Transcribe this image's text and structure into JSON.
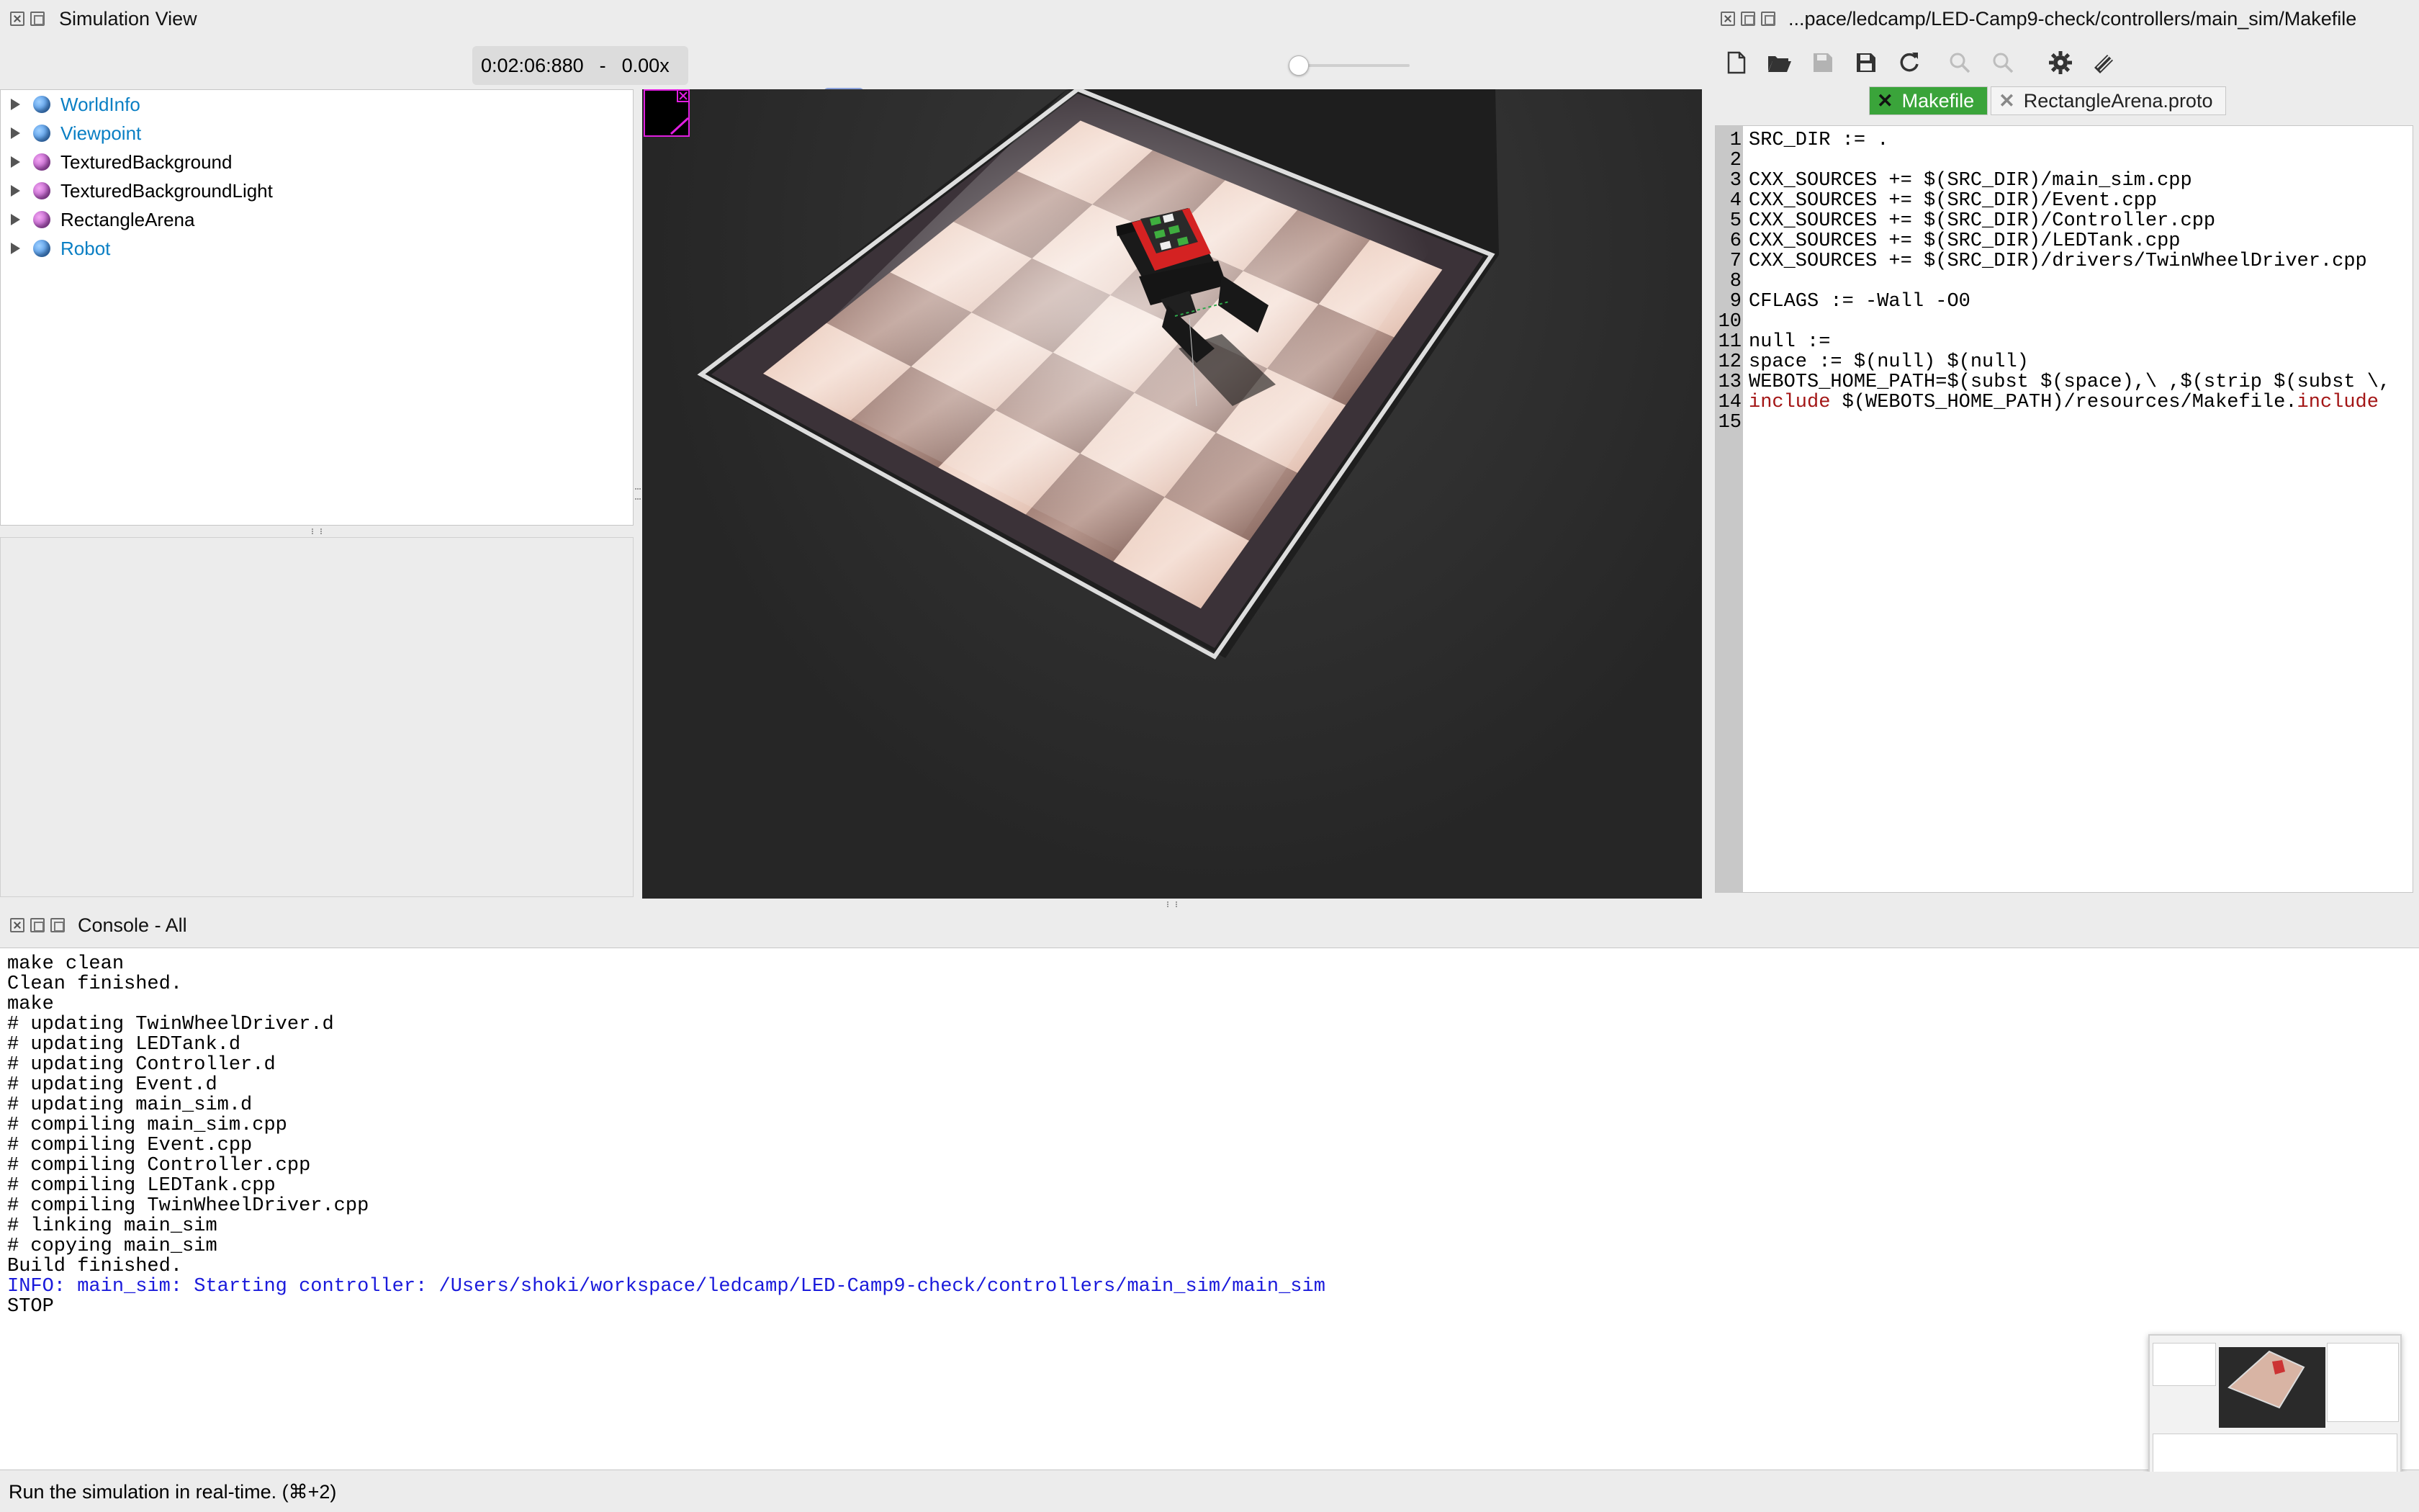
{
  "sim": {
    "title": "Simulation View",
    "time": "0:02:06:880",
    "dash": "-",
    "speed": "0.00x"
  },
  "toolbar": {
    "icons": [
      "toggle-scene-tree-icon",
      "add-node-icon",
      "reset-view-icon",
      "eye-icon",
      "open-world-icon",
      "save-world-icon",
      "reload-world-icon",
      "step-back-icon",
      "step-icon",
      "play-icon",
      "fast-forward-icon",
      "projection-icon",
      "movie-icon",
      "record-icon",
      "screenshot-icon",
      "mute-icon"
    ],
    "volume": 0.05
  },
  "tree": {
    "items": [
      {
        "label": "WorldInfo",
        "color": "blue",
        "highlight": true
      },
      {
        "label": "Viewpoint",
        "color": "blue",
        "highlight": true
      },
      {
        "label": "TexturedBackground",
        "color": "purple",
        "highlight": false
      },
      {
        "label": "TexturedBackgroundLight",
        "color": "purple",
        "highlight": false
      },
      {
        "label": "RectangleArena",
        "color": "purple",
        "highlight": false
      },
      {
        "label": "Robot",
        "color": "blue",
        "highlight": true
      }
    ]
  },
  "editor": {
    "title": "...pace/ledcamp/LED-Camp9-check/controllers/main_sim/Makefile",
    "tabs": [
      {
        "label": "Makefile",
        "active": true
      },
      {
        "label": "RectangleArena.proto",
        "active": false
      }
    ],
    "lines": [
      [
        {
          "t": "SRC_DIR := ."
        }
      ],
      [
        {
          "t": ""
        }
      ],
      [
        {
          "t": "CXX_SOURCES += $(SRC_DIR)/main_sim.cpp"
        }
      ],
      [
        {
          "t": "CXX_SOURCES += $(SRC_DIR)/Event.cpp"
        }
      ],
      [
        {
          "t": "CXX_SOURCES += $(SRC_DIR)/Controller.cpp"
        }
      ],
      [
        {
          "t": "CXX_SOURCES += $(SRC_DIR)/LEDTank.cpp"
        }
      ],
      [
        {
          "t": "CXX_SOURCES += $(SRC_DIR)/drivers/TwinWheelDriver.cpp"
        }
      ],
      [
        {
          "t": ""
        }
      ],
      [
        {
          "t": "CFLAGS := -Wall -O0"
        }
      ],
      [
        {
          "t": ""
        }
      ],
      [
        {
          "t": "null :="
        }
      ],
      [
        {
          "t": "space := $(null) $(null)"
        }
      ],
      [
        {
          "t": "WEBOTS_HOME_PATH=$(subst $(space),\\ ,$(strip $(subst \\,"
        }
      ],
      [
        {
          "t": "include",
          "k": true
        },
        {
          "t": " $(WEBOTS_HOME_PATH)/resources/Makefile."
        },
        {
          "t": "include",
          "k": true
        }
      ],
      [
        {
          "t": ""
        }
      ]
    ]
  },
  "console": {
    "title": "Console - All",
    "lines": [
      {
        "t": "make clean"
      },
      {
        "t": "Clean finished."
      },
      {
        "t": "make"
      },
      {
        "t": "# updating TwinWheelDriver.d"
      },
      {
        "t": "# updating LEDTank.d"
      },
      {
        "t": "# updating Controller.d"
      },
      {
        "t": "# updating Event.d"
      },
      {
        "t": "# updating main_sim.d"
      },
      {
        "t": "# compiling main_sim.cpp"
      },
      {
        "t": "# compiling Event.cpp"
      },
      {
        "t": "# compiling Controller.cpp"
      },
      {
        "t": "# compiling LEDTank.cpp"
      },
      {
        "t": "# compiling TwinWheelDriver.cpp"
      },
      {
        "t": "# linking main_sim"
      },
      {
        "t": "# copying main_sim"
      },
      {
        "t": "Build finished."
      },
      {
        "t": "INFO: main_sim: Starting controller: /Users/shoki/workspace/ledcamp/LED-Camp9-check/controllers/main_sim/main_sim",
        "info": true
      },
      {
        "t": "STOP"
      }
    ]
  },
  "status": {
    "text": "Run the simulation in real-time. (⌘+2)"
  },
  "colors": {
    "accent": "#3aa43a",
    "info": "#1a1adb",
    "keyword": "#a31515",
    "tree_link": "#0a7fc4"
  }
}
